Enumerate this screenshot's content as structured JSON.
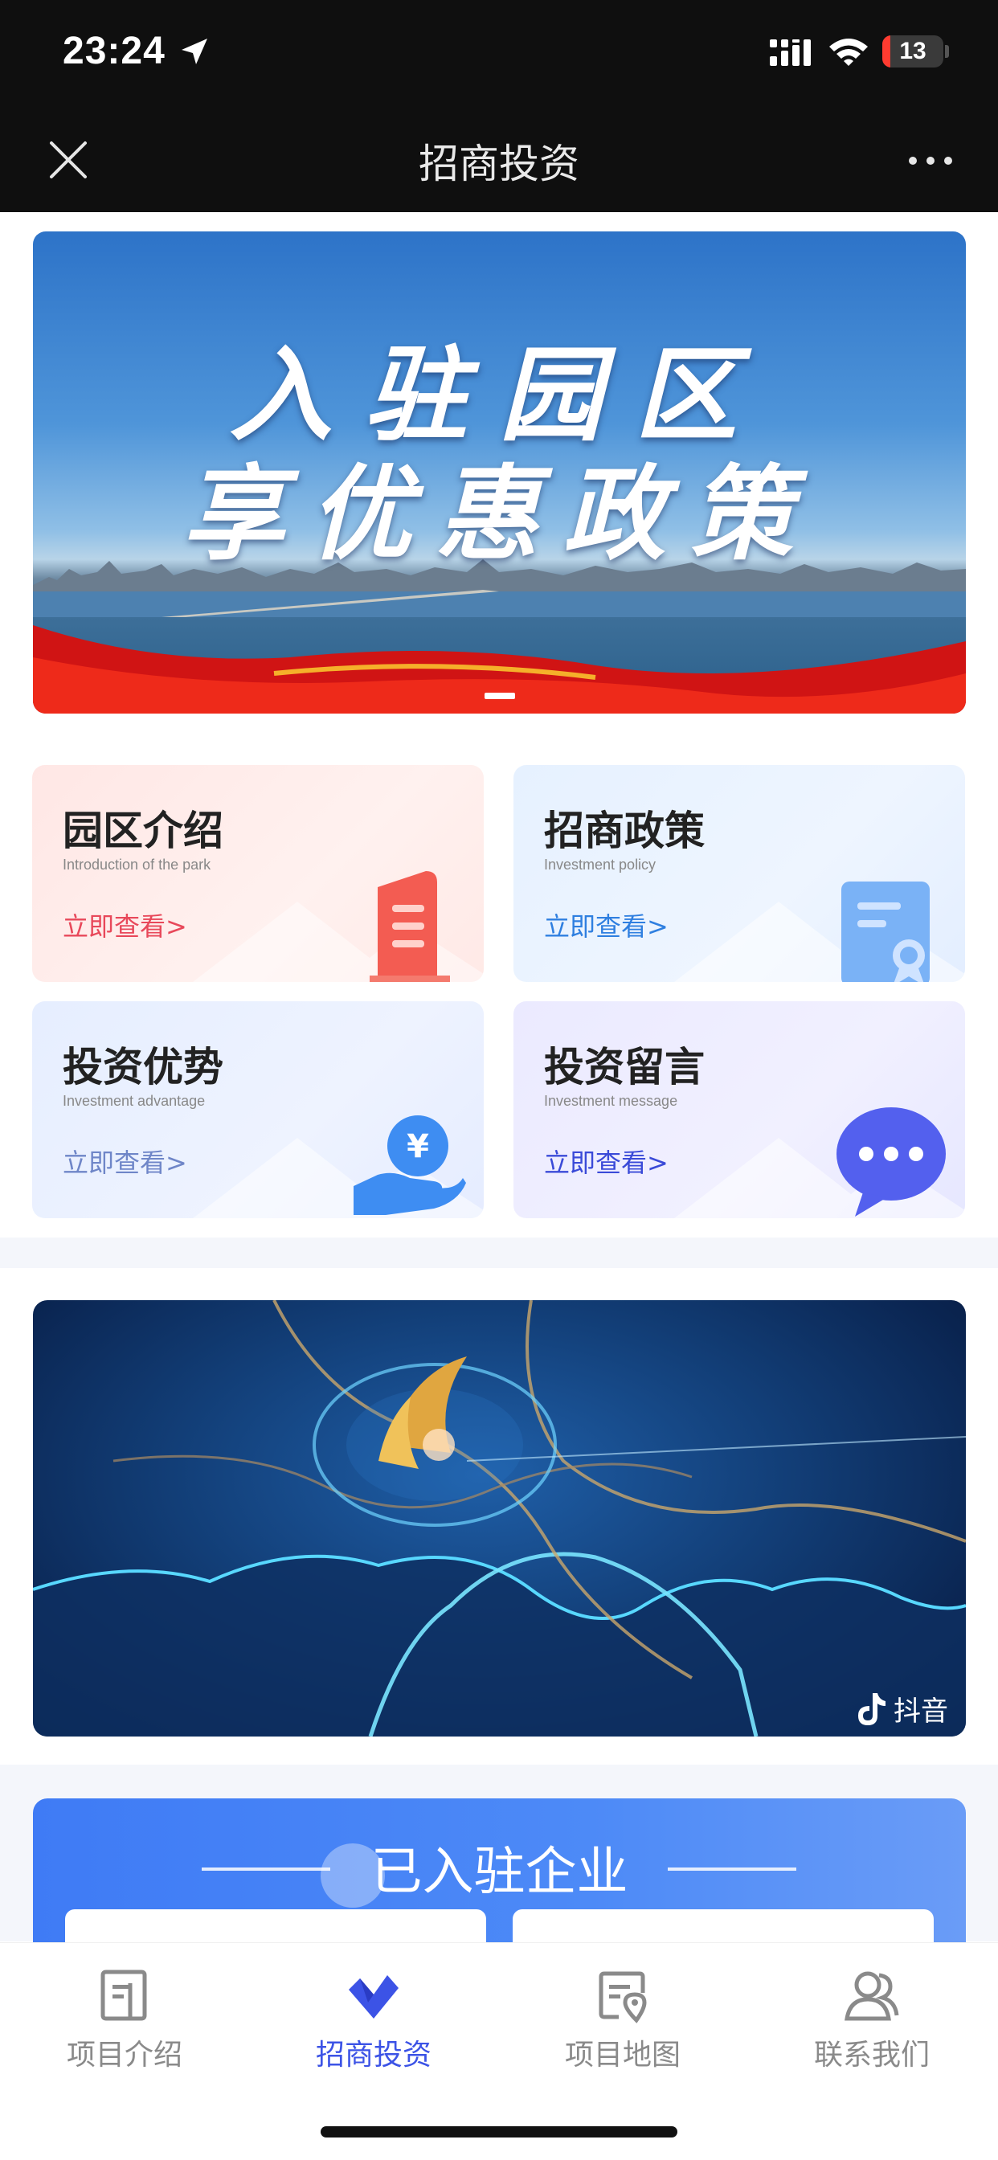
{
  "status_bar": {
    "time": "23:24",
    "battery_level": "13",
    "battery_fraction": 0.13,
    "icons": [
      "location-arrow-icon",
      "cellular-signal-icon",
      "wifi-icon",
      "battery-charging-icon"
    ]
  },
  "nav": {
    "title": "招商投资",
    "close_icon": "close-icon",
    "more_icon": "more-icon"
  },
  "banner": {
    "line1": "入驻园区",
    "line2": "享优惠政策",
    "page_indicator": {
      "current": 1
    }
  },
  "cards": [
    {
      "title": "园区介绍",
      "subtitle": "Introduction of the park",
      "link": "立即查看>",
      "icon": "document-icon",
      "accent": "#e8485a"
    },
    {
      "title": "招商政策",
      "subtitle": "Investment policy",
      "link": "立即查看>",
      "icon": "certificate-icon",
      "accent": "#2f7fe0"
    },
    {
      "title": "投资优势",
      "subtitle": "Investment advantage",
      "link": "立即查看>",
      "icon": "yuan-hand-icon",
      "accent": "#6f86c8"
    },
    {
      "title": "投资留言",
      "subtitle": "Investment message",
      "link": "立即查看>",
      "icon": "chat-bubble-icon",
      "accent": "#3a4ad8"
    }
  ],
  "video": {
    "platform_label": "抖音",
    "platform_icon": "douyin-icon"
  },
  "enterprises": {
    "title": "已入驻企业"
  },
  "tabbar": {
    "items": [
      {
        "label": "项目介绍",
        "icon": "project-doc-icon",
        "active": false
      },
      {
        "label": "招商投资",
        "icon": "investment-icon",
        "active": true
      },
      {
        "label": "项目地图",
        "icon": "map-pin-icon",
        "active": false
      },
      {
        "label": "联系我们",
        "icon": "contacts-icon",
        "active": false
      }
    ],
    "active_color": "#3c53e6",
    "inactive_color": "#8a8a8a"
  }
}
